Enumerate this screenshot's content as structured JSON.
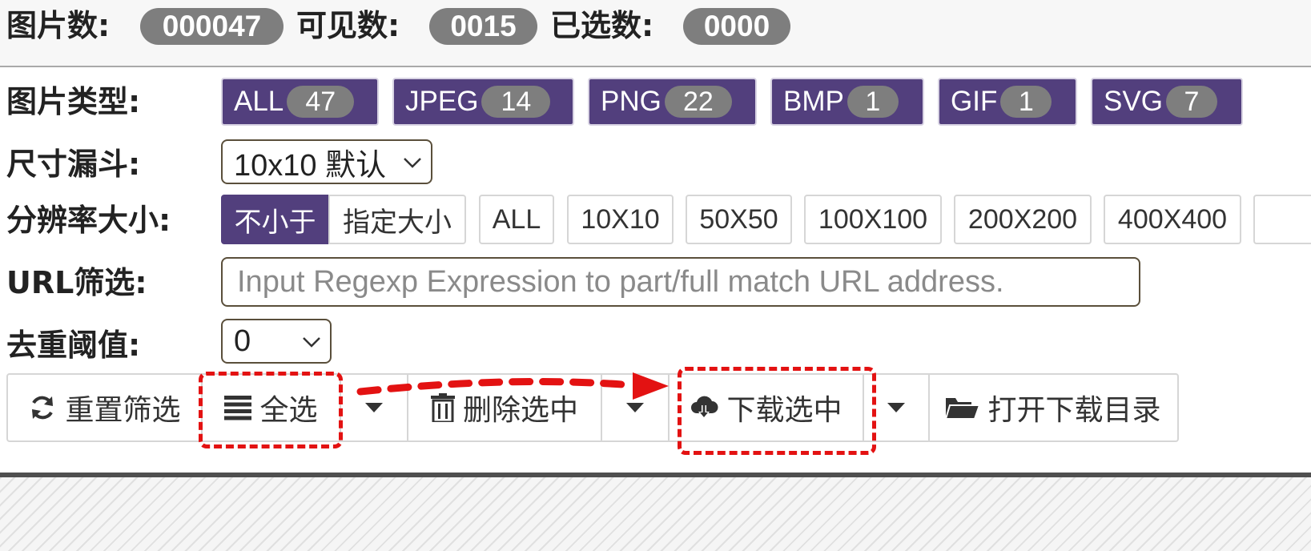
{
  "stats": {
    "image_count_label": "图片数:",
    "image_count_value": "000047",
    "visible_count_label": "可见数:",
    "visible_count_value": "0015",
    "selected_count_label": "已选数:",
    "selected_count_value": "0000"
  },
  "image_type": {
    "label": "图片类型:",
    "options": [
      {
        "label": "ALL",
        "count": "47"
      },
      {
        "label": "JPEG",
        "count": "14"
      },
      {
        "label": "PNG",
        "count": "22"
      },
      {
        "label": "BMP",
        "count": "1"
      },
      {
        "label": "GIF",
        "count": "1"
      },
      {
        "label": "SVG",
        "count": "7"
      }
    ]
  },
  "size_funnel": {
    "label": "尺寸漏斗:",
    "selected": "10x10 默认"
  },
  "resolution": {
    "label": "分辨率大小:",
    "mode_options": [
      "不小于",
      "指定大小"
    ],
    "active_mode": "不小于",
    "size_options": [
      "ALL",
      "10X10",
      "50X50",
      "100X100",
      "200X200",
      "400X400"
    ]
  },
  "url_filter": {
    "label": "URL筛选:",
    "placeholder": "Input Regexp Expression to part/full match URL address.",
    "value": ""
  },
  "dedupe": {
    "label": "去重阈值:",
    "selected": "0"
  },
  "toolbar": {
    "reset_label": "重置筛选",
    "select_all_label": "全选",
    "delete_label": "删除选中",
    "download_label": "下载选中",
    "open_dir_label": "打开下载目录"
  },
  "icons": {
    "reset": "refresh-icon",
    "select_all": "list-icon",
    "delete": "trash-icon",
    "download": "cloud-download-icon",
    "open_dir": "folder-open-icon",
    "dropdown": "caret-down-icon"
  },
  "colors": {
    "accent_purple": "#523f7d",
    "pill_gray": "#7e7e7e",
    "annotation_red": "#e31212"
  }
}
